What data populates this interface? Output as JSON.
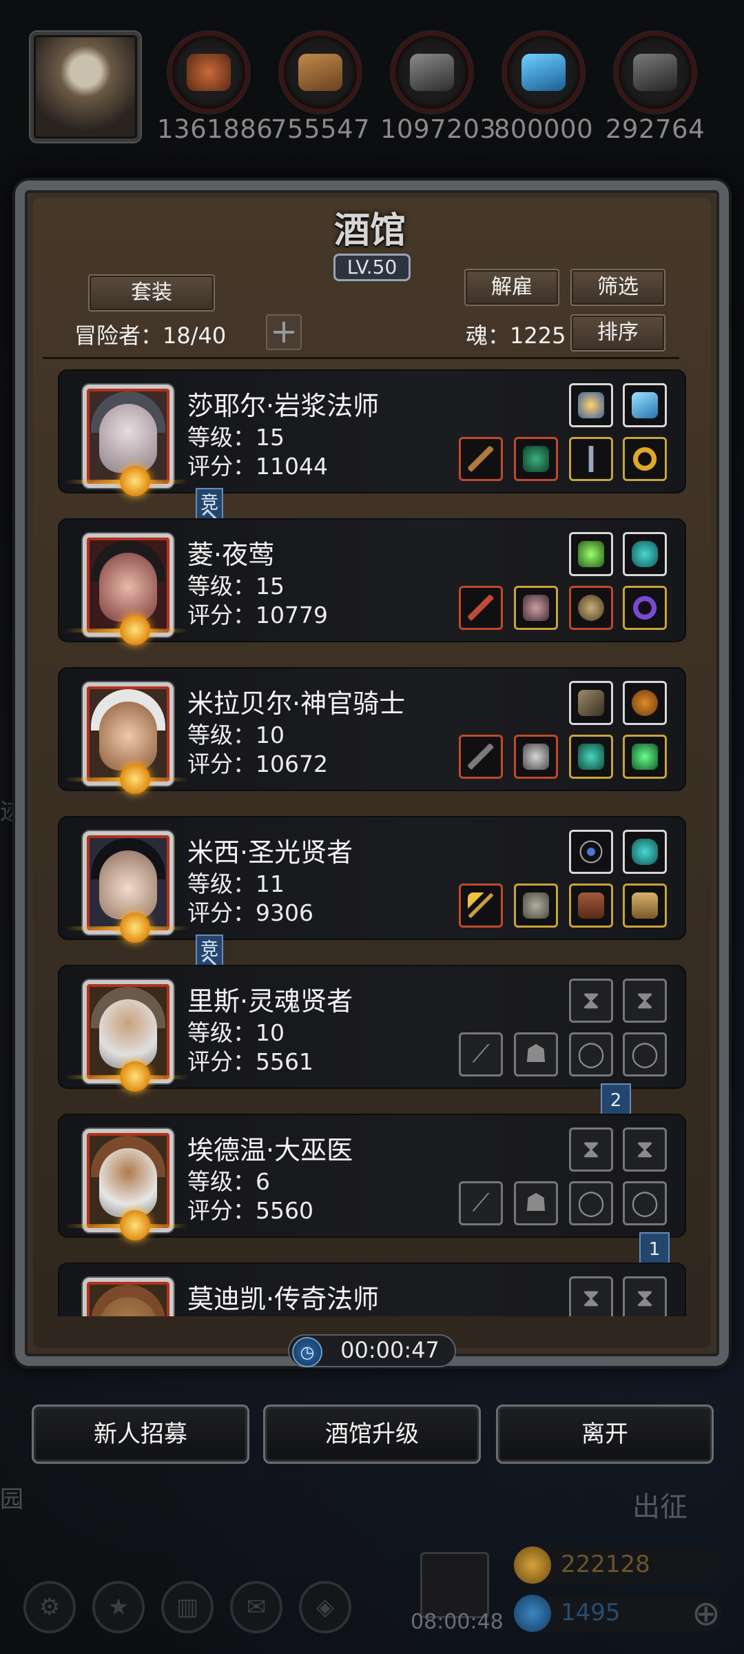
{
  "resources": [
    {
      "icon": "ore-icon",
      "value": "1361886",
      "color": "#a5532a"
    },
    {
      "icon": "wood-icon",
      "value": "755547",
      "color": "#9a6b3a"
    },
    {
      "icon": "iron-icon",
      "value": "1097203",
      "color": "#6a6a6a"
    },
    {
      "icon": "crystal-icon",
      "value": "800000",
      "color": "#2f8fc8"
    },
    {
      "icon": "steel-icon",
      "value": "292764",
      "color": "#5a5a5a"
    }
  ],
  "tavern": {
    "title": "酒馆",
    "level": "LV.50",
    "set_button": "套装",
    "dismiss_button": "解雇",
    "filter_button": "筛选",
    "sort_button": "排序",
    "adventurers_label": "冒险者：18/40",
    "soul_label": "魂：1225"
  },
  "adventurers": [
    {
      "name": "莎耶尔·岩浆法师",
      "level": "等级：15",
      "score": "评分：11044",
      "ribbon": "竞",
      "ghost": false
    },
    {
      "name": "菱·夜莺",
      "level": "等级：15",
      "score": "评分：10779",
      "ribbon": "",
      "ghost": false
    },
    {
      "name": "米拉贝尔·神官骑士",
      "level": "等级：10",
      "score": "评分：10672",
      "ribbon": "竞",
      "ghost": false
    },
    {
      "name": "米西·圣光贤者",
      "level": "等级：11",
      "score": "评分：9306",
      "ribbon": "",
      "ghost": false
    },
    {
      "name": "里斯·灵魂贤者",
      "level": "等级：10",
      "score": "评分：5561",
      "tag": "2",
      "ghost": true
    },
    {
      "name": "埃德温·大巫医",
      "level": "等级：6",
      "score": "评分：5560",
      "tag": "1",
      "ghost": true
    },
    {
      "name": "莫迪凯·传奇法师",
      "level": "",
      "score": "",
      "ghost": false
    }
  ],
  "timer": "00:00:47",
  "buttons": {
    "recruit": "新人招募",
    "upgrade": "酒馆升级",
    "leave": "离开"
  },
  "hud": {
    "left_label": "园",
    "side_label": "迹",
    "expedition": "出征",
    "gift_timer": "08:00:48",
    "gold": "222128",
    "gems": "1495"
  },
  "colors": {
    "accent_gold": "#c9a43a",
    "frame_red": "#b2321c",
    "ribbon_blue": "#23466e"
  }
}
